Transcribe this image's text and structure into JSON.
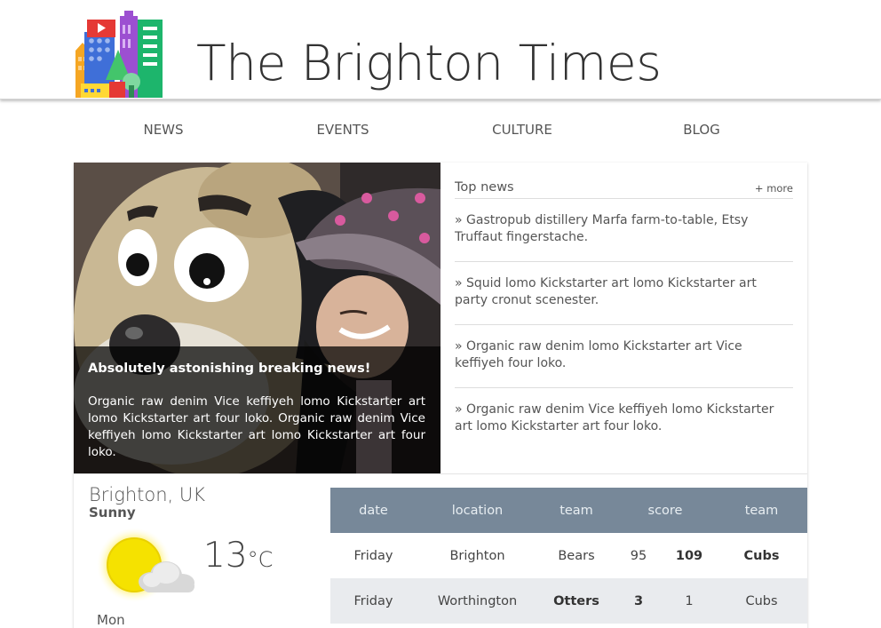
{
  "site": {
    "title": "The Brighton Times"
  },
  "nav": [
    {
      "label": "NEWS"
    },
    {
      "label": "EVENTS"
    },
    {
      "label": "CULTURE"
    },
    {
      "label": "BLOG"
    }
  ],
  "hero": {
    "headline": "Absolutely astonishing breaking news!",
    "text": "Organic raw denim Vice keffiyeh lomo Kickstarter art lomo Kickstarter art four loko. Organic raw denim Vice keffiyeh lomo Kickstarter art lomo Kickstarter art four loko."
  },
  "top_news": {
    "title": "Top news",
    "more_label": "+ more",
    "items": [
      {
        "text": "» Gastropub distillery Marfa farm-to-table, Etsy Truffaut fingerstache."
      },
      {
        "text": "» Squid lomo Kickstarter art lomo Kickstarter art party cronut scenester."
      },
      {
        "text": "» Organic raw denim lomo Kickstarter art Vice keffiyeh four loko."
      },
      {
        "text": "» Organic raw denim Vice keffiyeh lomo Kickstarter art lomo Kickstarter art four loko."
      }
    ]
  },
  "weather": {
    "city": "Brighton, UK",
    "condition": "Sunny",
    "temperature": "13",
    "unit": "°C",
    "day": "Mon",
    "icon": "sun-cloud-icon"
  },
  "scores": {
    "headers": [
      "date",
      "location",
      "team",
      "score",
      "team"
    ],
    "rows": [
      {
        "date": "Friday",
        "location": "Brighton",
        "team1": "Bears",
        "score1": "95",
        "score2": "109",
        "team2": "Cubs",
        "winner": 2
      },
      {
        "date": "Friday",
        "location": "Worthington",
        "team1": "Otters",
        "score1": "3",
        "score2": "1",
        "team2": "Cubs",
        "winner": 1
      }
    ]
  },
  "colors": {
    "table_header": "#778899",
    "alt_row": "#e9ebee",
    "caption_bg": "#000000"
  }
}
